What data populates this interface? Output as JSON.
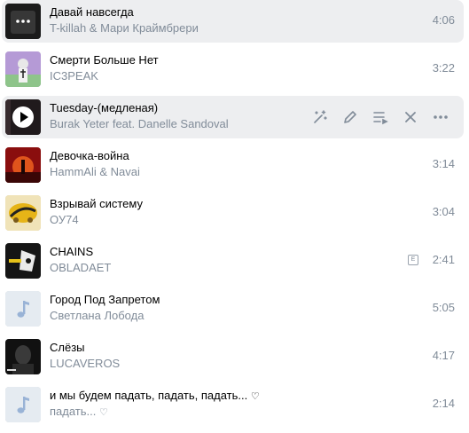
{
  "tracks": [
    {
      "title": "Давай навсегда",
      "artist": "T-killah & Мари Краймбрери",
      "duration": "4:06",
      "state": "paused"
    },
    {
      "title": "Смерти Больше Нет",
      "artist": "IC3PEAK",
      "duration": "3:22"
    },
    {
      "title": "Tuesday-(медленая)",
      "artist": "Burak Yeter feat. Danelle Sandoval",
      "duration": "",
      "state": "hover"
    },
    {
      "title": "Девочка-война",
      "artist": "HammAli & Navai",
      "duration": "3:14"
    },
    {
      "title": "Взрывай систему",
      "artist": "ОУ74",
      "duration": "3:04"
    },
    {
      "title": "CHAINS",
      "artist": "OBLADAET",
      "duration": "2:41",
      "explicit": "E"
    },
    {
      "title": "Город Под Запретом",
      "artist": "Светлана Лобода",
      "duration": "5:05",
      "cover": "music-note-placeholder"
    },
    {
      "title": "Слёзы",
      "artist": "LUCAVEROS",
      "duration": "4:17"
    },
    {
      "title": "и мы будем падать, падать, падать...",
      "title_suffix": "♡",
      "artist": "падать...",
      "artist_suffix": "♡",
      "duration": "2:14",
      "cover": "music-note-placeholder"
    }
  ],
  "colors": {
    "accent": "#2688eb",
    "secondary_text": "#818c99",
    "row_highlight": "#edeef0",
    "placeholder_bg": "#e5ebf1"
  },
  "icons": [
    "more-dots-icon",
    "play-icon",
    "magic-wand-icon",
    "edit-pencil-icon",
    "add-to-queue-icon",
    "remove-icon",
    "more-horizontal-icon",
    "music-note-icon"
  ]
}
